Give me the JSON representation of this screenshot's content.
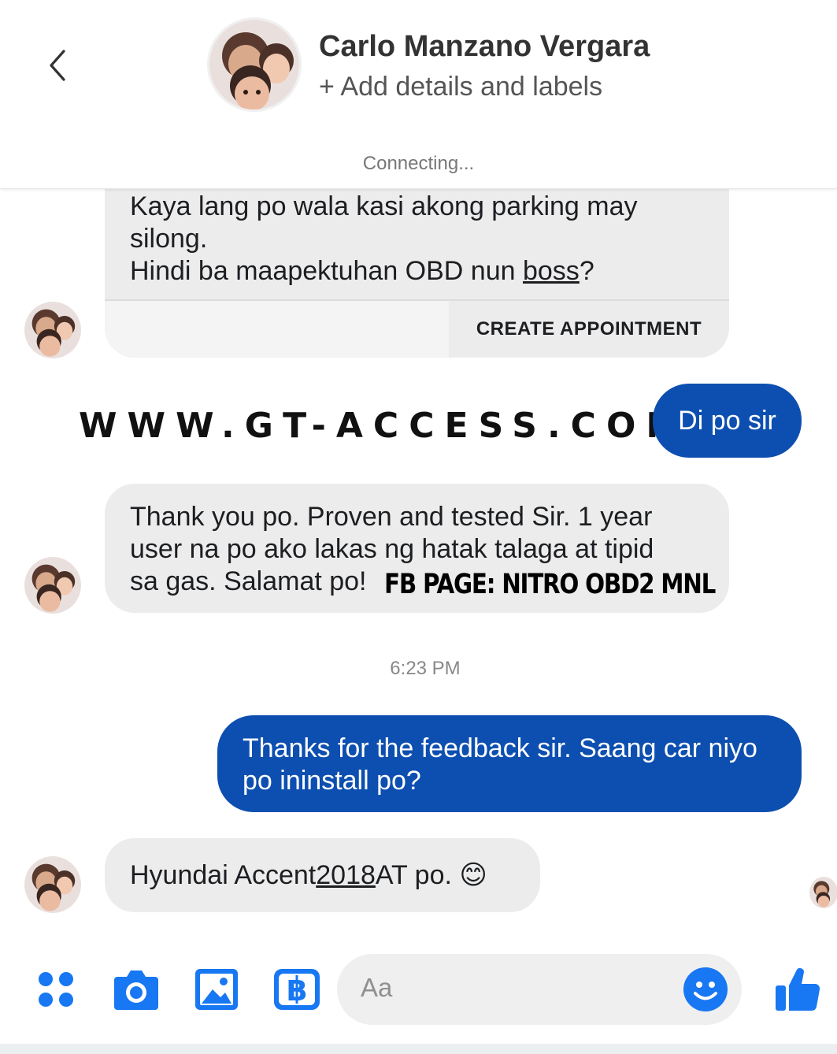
{
  "header": {
    "contact_name": "Carlo Manzano Vergara",
    "add_details": "+ Add details and labels",
    "status": "Connecting..."
  },
  "messages": {
    "m1_line1": "Kaya lang po wala kasi akong parking may",
    "m1_line2": "silong.",
    "m1_line3_pre": "Hindi ba maapektuhan OBD nun ",
    "m1_line3_link": "boss",
    "m1_line3_post": "?",
    "m1_action": "CREATE APPOINTMENT",
    "watermark": "WWW.GT-ACCESS.COM",
    "m2_reply": "Di po sir",
    "m3_line1": "Thank you po. Proven and tested Sir. 1 year",
    "m3_line2": "user na po ako lakas ng hatak talaga at tipid",
    "m3_line3": "sa gas. Salamat po!",
    "fb_page": "FB PAGE: NITRO OBD2 MNL",
    "time": "6:23 PM",
    "m4_line1": "Thanks for the feedback sir. Saang car niyo",
    "m4_line2": "po ininstall po?",
    "m5_pre": "Hyundai Accent ",
    "m5_link": "2018",
    "m5_post": " AT po.",
    "m5_emoji": "😊"
  },
  "composer": {
    "placeholder": "Aa"
  },
  "icons": {
    "back": "back-chevron-icon",
    "menu": "four-dots-icon",
    "camera": "camera-icon",
    "gallery": "image-icon",
    "sticker": "b-sticker-icon",
    "emoji": "smiley-icon",
    "like": "thumbs-up-icon"
  },
  "colors": {
    "accent": "#1877f2",
    "outgoing_bubble": "#0d4fb0",
    "incoming_bubble": "#ececec"
  }
}
